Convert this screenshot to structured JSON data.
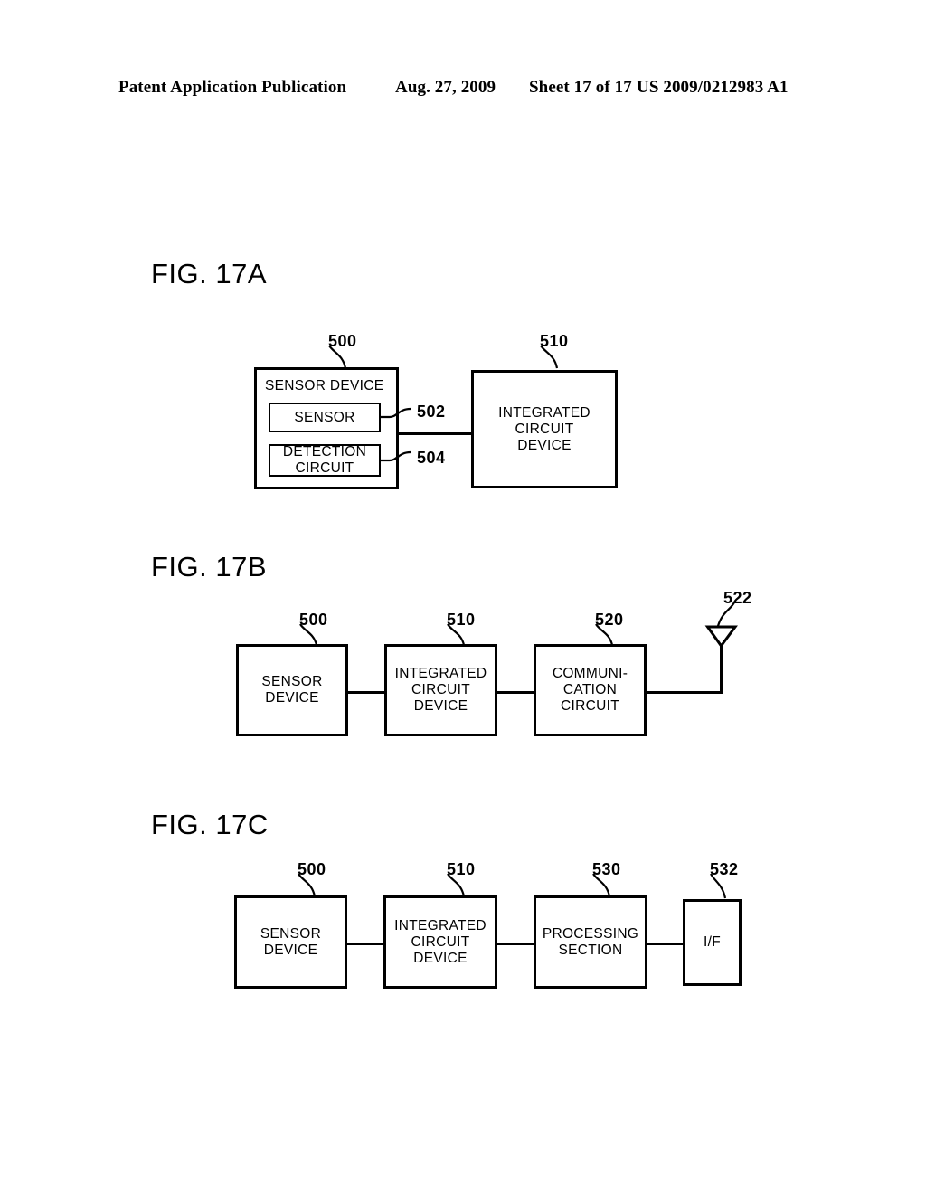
{
  "header": {
    "publication": "Patent Application Publication",
    "date": "Aug. 27, 2009",
    "sheet": "Sheet 17 of 17",
    "patent_number": "US 2009/0212983 A1"
  },
  "figures": [
    {
      "label": "FIG. 17A",
      "boxes": [
        {
          "name": "sensor-device",
          "label": "SENSOR DEVICE",
          "ref": "500"
        },
        {
          "name": "sensor",
          "label": "SENSOR",
          "ref": "502"
        },
        {
          "name": "detection-circuit",
          "label": "DETECTION\nCIRCUIT",
          "ref": "504"
        },
        {
          "name": "integrated-circuit-device",
          "label": "INTEGRATED\nCIRCUIT\nDEVICE",
          "ref": "510"
        }
      ]
    },
    {
      "label": "FIG. 17B",
      "boxes": [
        {
          "name": "sensor-device",
          "label": "SENSOR\nDEVICE",
          "ref": "500"
        },
        {
          "name": "integrated-circuit-device",
          "label": "INTEGRATED\nCIRCUIT\nDEVICE",
          "ref": "510"
        },
        {
          "name": "communication-circuit",
          "label": "COMMUNI-\nCATION\nCIRCUIT",
          "ref": "520"
        },
        {
          "name": "antenna",
          "label": "",
          "ref": "522"
        }
      ]
    },
    {
      "label": "FIG. 17C",
      "boxes": [
        {
          "name": "sensor-device",
          "label": "SENSOR\nDEVICE",
          "ref": "500"
        },
        {
          "name": "integrated-circuit-device",
          "label": "INTEGRATED\nCIRCUIT\nDEVICE",
          "ref": "510"
        },
        {
          "name": "processing-section",
          "label": "PROCESSING\nSECTION",
          "ref": "530"
        },
        {
          "name": "interface",
          "label": "I/F",
          "ref": "532"
        }
      ]
    }
  ],
  "colors": {
    "ink": "#000000",
    "paper": "#ffffff"
  }
}
